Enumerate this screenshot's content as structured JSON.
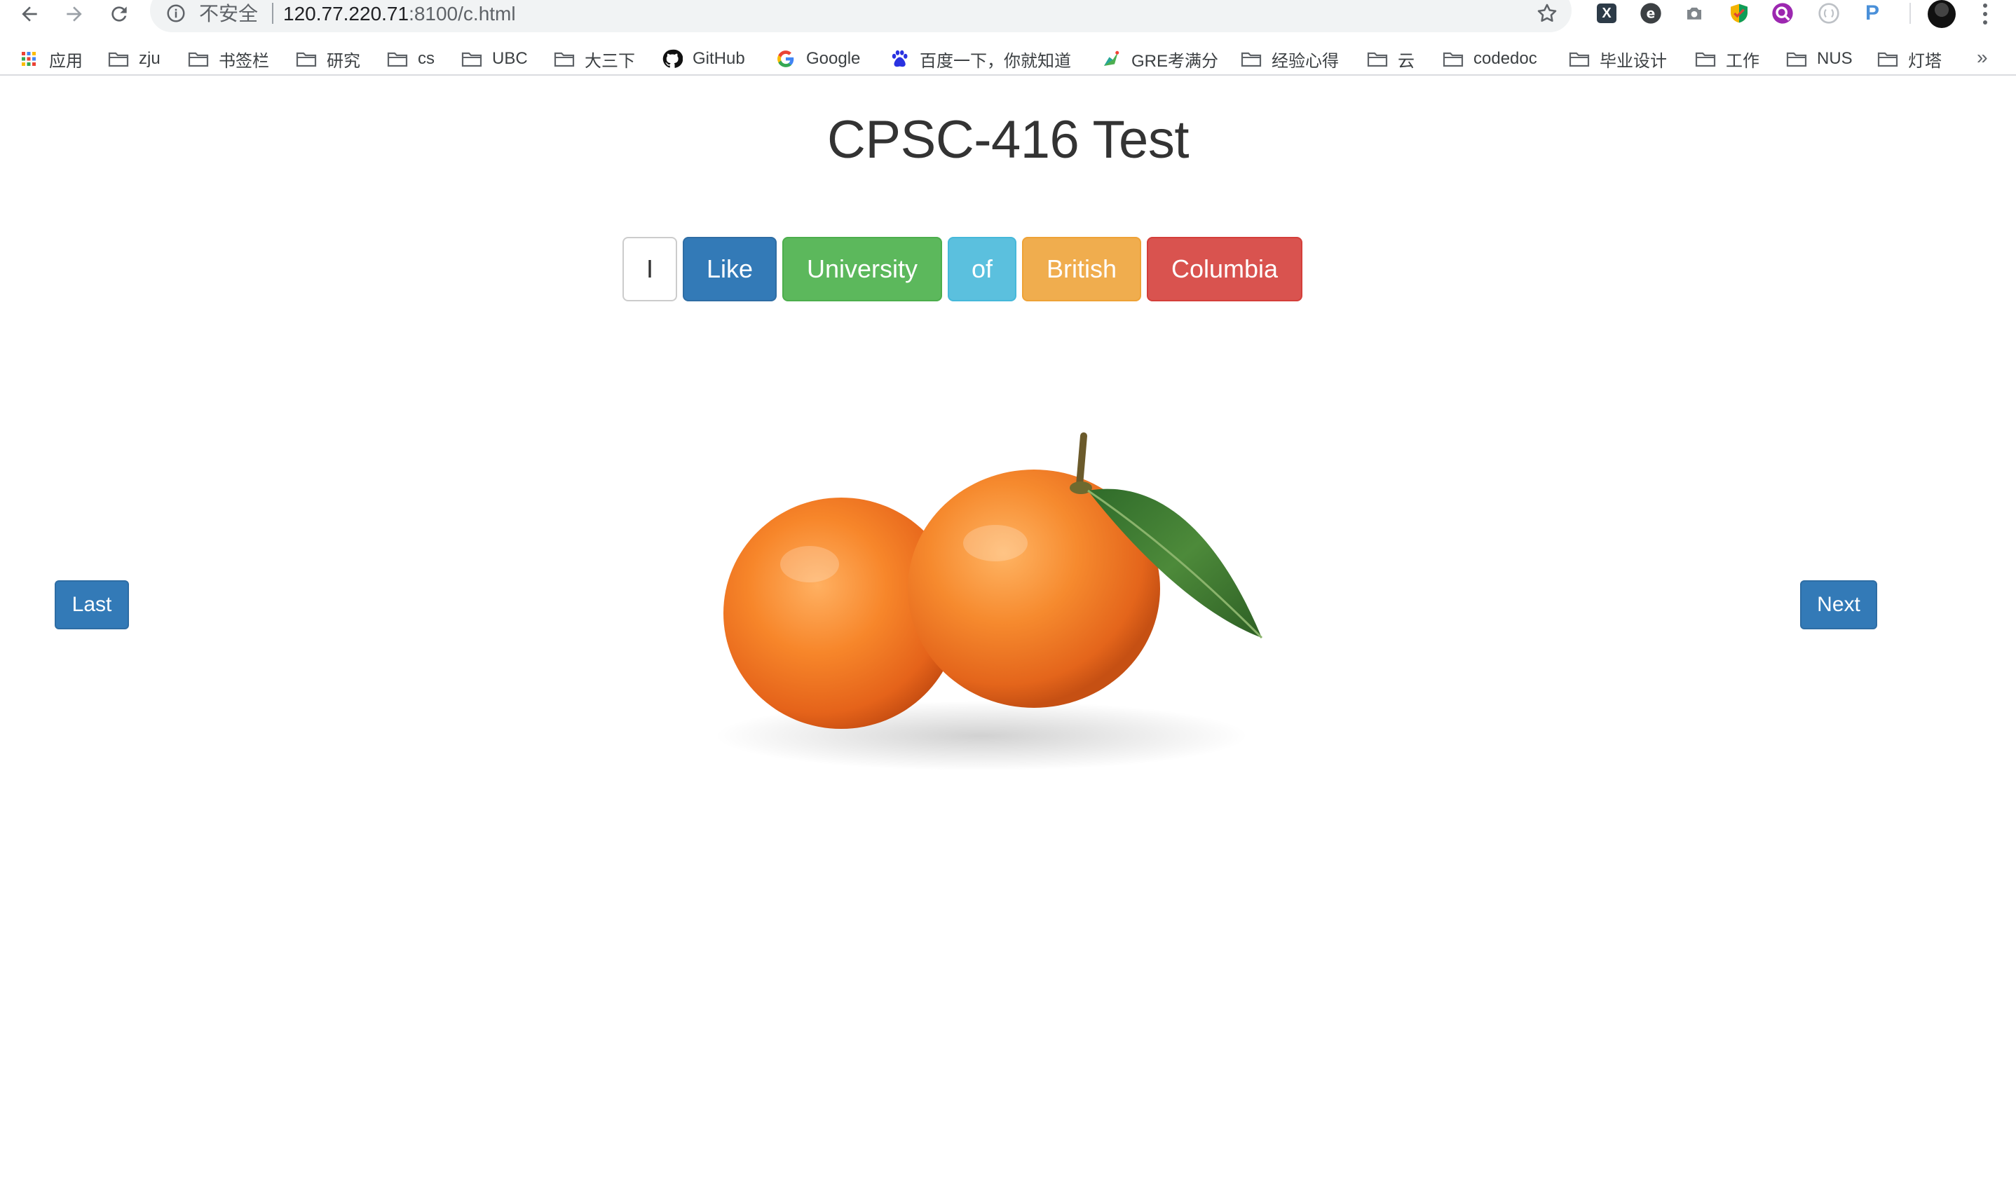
{
  "browser": {
    "security_label": "不安全",
    "url_host": "120.77.220.71",
    "url_rest": ":8100/c.html",
    "nav_icons": [
      "back-arrow-icon",
      "forward-arrow-icon",
      "reload-icon"
    ],
    "extensions": [
      "x-extension-icon",
      "e-extension-icon",
      "camera-icon",
      "shield-extension-icon",
      "search-extension-icon",
      "circle-extension-icon",
      "p-extension-icon"
    ],
    "extension_p_label": "P",
    "extension_x_label": "X",
    "extension_e_label": "e"
  },
  "bookmarks": {
    "items": [
      {
        "label": "应用",
        "icon": "apps-grid-icon"
      },
      {
        "label": "zju",
        "icon": "folder-icon"
      },
      {
        "label": "书签栏",
        "icon": "folder-icon"
      },
      {
        "label": "研究",
        "icon": "folder-icon"
      },
      {
        "label": "cs",
        "icon": "folder-icon"
      },
      {
        "label": "UBC",
        "icon": "folder-icon"
      },
      {
        "label": "大三下",
        "icon": "folder-icon"
      },
      {
        "label": "GitHub",
        "icon": "github-icon"
      },
      {
        "label": "Google",
        "icon": "google-icon"
      },
      {
        "label": "百度一下，你就知道",
        "icon": "baidu-icon"
      },
      {
        "label": "GRE考满分",
        "icon": "gre-icon"
      },
      {
        "label": "经验心得",
        "icon": "folder-icon"
      },
      {
        "label": "云",
        "icon": "folder-icon"
      },
      {
        "label": "codedoc",
        "icon": "folder-icon"
      },
      {
        "label": "毕业设计",
        "icon": "folder-icon"
      },
      {
        "label": "工作",
        "icon": "folder-icon"
      },
      {
        "label": "NUS",
        "icon": "folder-icon"
      },
      {
        "label": "灯塔",
        "icon": "folder-icon"
      }
    ],
    "more": "»"
  },
  "page": {
    "title": "CPSC-416 Test",
    "words": [
      "I",
      "Like",
      "University",
      "of",
      "British",
      "Columbia"
    ],
    "last_button": "Last",
    "next_button": "Next"
  },
  "colors": {
    "primary": "#337ab7",
    "success": "#5cb85c",
    "info": "#5bc0de",
    "warning": "#f0ad4e",
    "danger": "#d9534f"
  }
}
